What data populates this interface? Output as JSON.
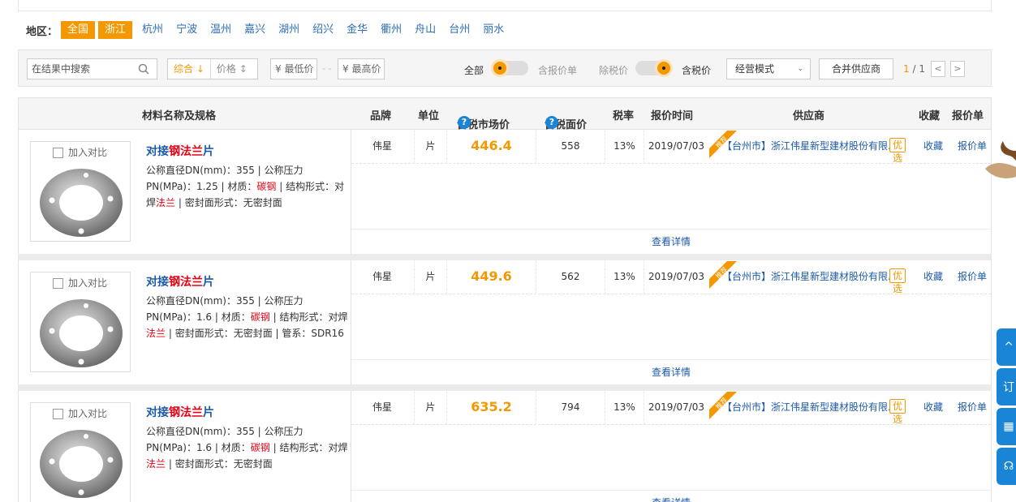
{
  "region": {
    "label": "地区：",
    "items": [
      "全国",
      "浙江",
      "杭州",
      "宁波",
      "温州",
      "嘉兴",
      "湖州",
      "绍兴",
      "金华",
      "衢州",
      "舟山",
      "台州",
      "丽水"
    ],
    "active": [
      "全国",
      "浙江"
    ]
  },
  "filter": {
    "search_placeholder": "在结果中搜索",
    "sort_label": "综合 ↓",
    "price_sort_label": "价格",
    "min_price_placeholder": "¥ 最低价",
    "max_price_placeholder": "¥ 最高价",
    "dash": "- -",
    "toggle1_left": "全部",
    "toggle1_right": "含报价单",
    "toggle2_left": "除税价",
    "toggle2_right": "含税价",
    "mode_select": "经营模式",
    "merge_button": "合并供应商",
    "page_current": "1",
    "page_total": "/ 1",
    "prev": "<",
    "next": ">"
  },
  "table": {
    "headers": {
      "name": "材料名称及规格",
      "brand": "品牌",
      "unit": "单位",
      "market_price": "含税市场价",
      "face_price": "含税面价",
      "tax": "税率",
      "time": "报价时间",
      "supplier": "供应商",
      "fav": "收藏",
      "quote": "报价单"
    },
    "compare_label": "加入对比",
    "detail_label": "查看详情",
    "rec_badge": "推荐",
    "preferred_badge": "优选",
    "fav_link": "收藏",
    "quote_link": "报价单",
    "rows": [
      {
        "name_a": "对接",
        "name_hl": "钢法兰",
        "name_b": "片",
        "desc": [
          {
            "t": "公称直径DN(mm)：355 | 公称压力PN(MPa)：1.25 | 材质：",
            "r": false
          },
          {
            "t": "碳钢",
            "r": true
          },
          {
            "t": " | 结构形式：对焊",
            "r": false
          },
          {
            "t": "法兰",
            "r": true
          },
          {
            "t": " | 密封面形式：无密封面",
            "r": false
          }
        ],
        "brand": "伟星",
        "unit": "片",
        "market_price": "446.4",
        "face_price": "558",
        "tax": "13%",
        "time": "2019/07/03",
        "supplier": "【台州市】浙江伟星新型建材股份有限..."
      },
      {
        "name_a": "对接",
        "name_hl": "钢法兰",
        "name_b": "片",
        "desc": [
          {
            "t": "公称直径DN(mm)：355 | 公称压力PN(MPa)：1.6 | 材质：",
            "r": false
          },
          {
            "t": "碳钢",
            "r": true
          },
          {
            "t": " | 结构形式：对焊",
            "r": false
          },
          {
            "t": "法兰",
            "r": true
          },
          {
            "t": " | 密封面形式：无密封面 | 管系：SDR16",
            "r": false
          }
        ],
        "brand": "伟星",
        "unit": "片",
        "market_price": "449.6",
        "face_price": "562",
        "tax": "13%",
        "time": "2019/07/03",
        "supplier": "【台州市】浙江伟星新型建材股份有限..."
      },
      {
        "name_a": "对接",
        "name_hl": "钢法兰",
        "name_b": "片",
        "desc": [
          {
            "t": "公称直径DN(mm)：355 | 公称压力PN(MPa)：1.6 | 材质：",
            "r": false
          },
          {
            "t": "碳钢",
            "r": true
          },
          {
            "t": " | 结构形式：对焊",
            "r": false
          },
          {
            "t": "法兰",
            "r": true
          },
          {
            "t": " | 密封面形式：无密封面",
            "r": false
          }
        ],
        "brand": "伟星",
        "unit": "片",
        "market_price": "635.2",
        "face_price": "794",
        "tax": "13%",
        "time": "2019/07/03",
        "supplier": "【台州市】浙江伟星新型建材股份有限..."
      }
    ]
  },
  "sidebar": [
    "^",
    "订",
    "▦",
    "☊"
  ],
  "colors": {
    "accent": "#f39800",
    "link": "#1d5aa8",
    "highlight": "#e60012",
    "sidebar": "#1a84d6"
  }
}
